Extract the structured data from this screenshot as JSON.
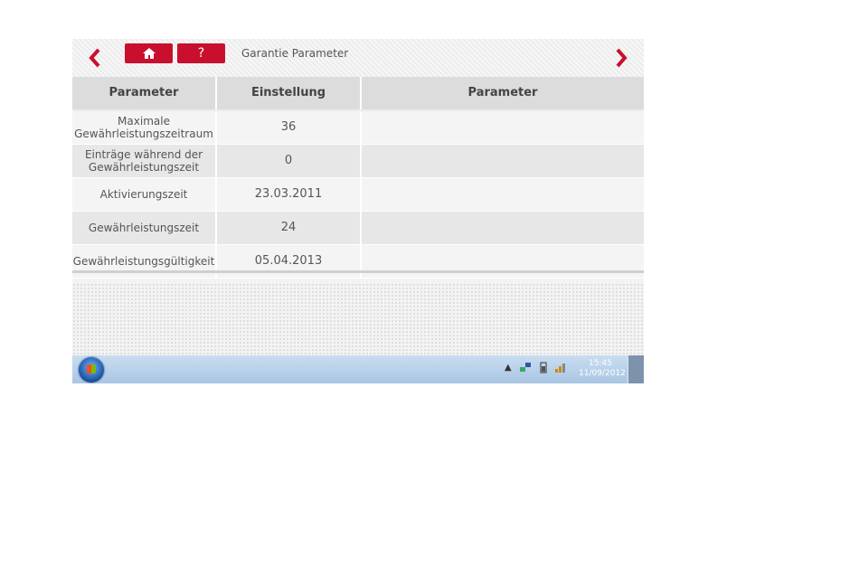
{
  "header": {
    "title": "Garantie Parameter",
    "back_icon": "chevron-left-icon",
    "forward_icon": "chevron-right-icon",
    "home_icon": "home-icon",
    "help_label": "?"
  },
  "table": {
    "columns": [
      "Parameter",
      "Einstellung",
      "Parameter"
    ],
    "rows": [
      {
        "name": "Maximale Gewährleistungszeitraum",
        "value": "36"
      },
      {
        "name": "Einträge während der Gewährleistungszeit",
        "value": "0"
      },
      {
        "name": "Aktivierungszeit",
        "value": "23.03.2011"
      },
      {
        "name": "Gewährleistungszeit",
        "value": "24"
      },
      {
        "name": "Gewährleistungsgültigkeit",
        "value": "05.04.2013"
      }
    ]
  },
  "taskbar": {
    "time": "15:45",
    "date": "11/09/2012"
  },
  "colors": {
    "accent": "#c8102e",
    "taskbar": "#b9d1ea"
  }
}
